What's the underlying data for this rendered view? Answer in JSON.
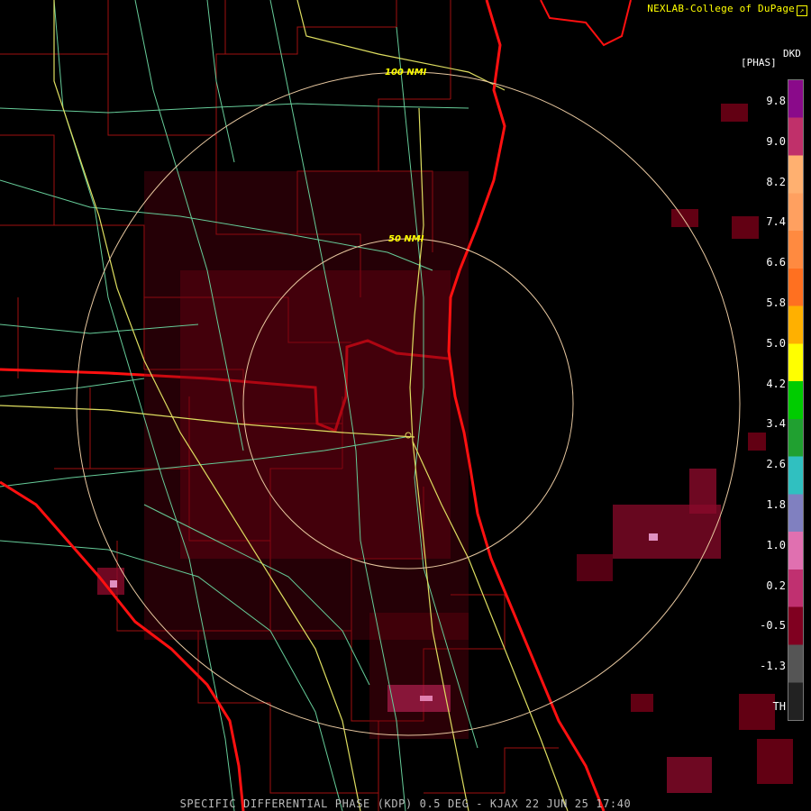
{
  "header": {
    "credit": "NEXLAB-College of DuPage",
    "credit_icon": "external-link-icon",
    "product_code": "DKD",
    "units": "[PHAS]"
  },
  "legend": {
    "ticks": [
      "9.8",
      "9.0",
      "8.2",
      "7.4",
      "6.6",
      "5.8",
      "5.0",
      "4.2",
      "3.4",
      "2.6",
      "1.8",
      "1.0",
      "0.2",
      "-0.5",
      "-1.3",
      "TH"
    ],
    "colors": [
      "#8a0a8a",
      "#c0306a",
      "#ffb070",
      "#ffa060",
      "#ff8a40",
      "#ff7020",
      "#ffb000",
      "#ffff00",
      "#00cc00",
      "#20a030",
      "#30c0c0",
      "#8080c0",
      "#e070b0",
      "#c03070",
      "#800020",
      "#555555",
      "#222222"
    ]
  },
  "map": {
    "ring_labels": [
      "100 NMI",
      "50 NMI"
    ],
    "colors": {
      "coast": "#ff1010",
      "county": "#b01010",
      "highway": "#dede60",
      "road": "#66cc99",
      "ring": "#e8c8a0"
    }
  },
  "footer": {
    "caption": "SPECIFIC DIFFERENTIAL PHASE (KDP) 0.5 DEG - KJAX 22 JUN 25 17:40"
  }
}
